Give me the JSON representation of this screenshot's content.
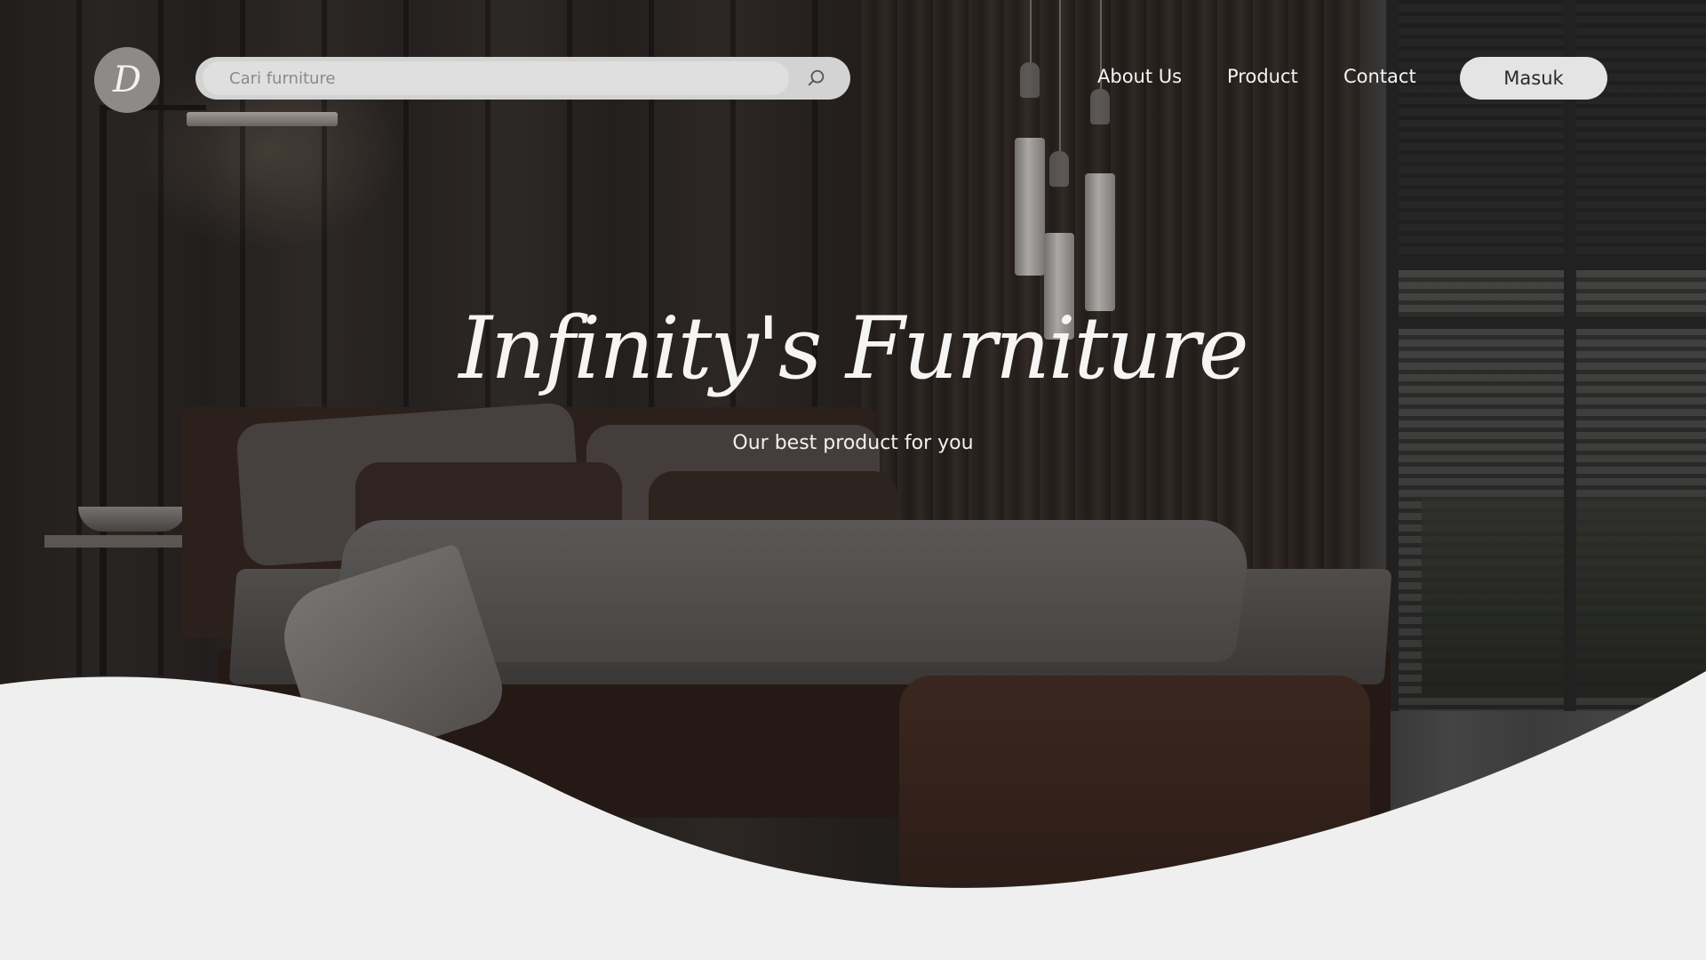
{
  "brand": {
    "logo_letter": "D"
  },
  "search": {
    "placeholder": "Cari furniture",
    "icon": "search-icon"
  },
  "nav": {
    "items": [
      {
        "label": "About Us"
      },
      {
        "label": "Product"
      },
      {
        "label": "Contact"
      }
    ],
    "login_label": "Masuk"
  },
  "hero": {
    "title": "Infinity's Furniture",
    "subtitle": "Our best product for you"
  },
  "colors": {
    "page_background": "#efefef",
    "login_button": "#e4e4e4",
    "search_bar": "#d3d3d3",
    "text_light": "#f5f3f1"
  }
}
